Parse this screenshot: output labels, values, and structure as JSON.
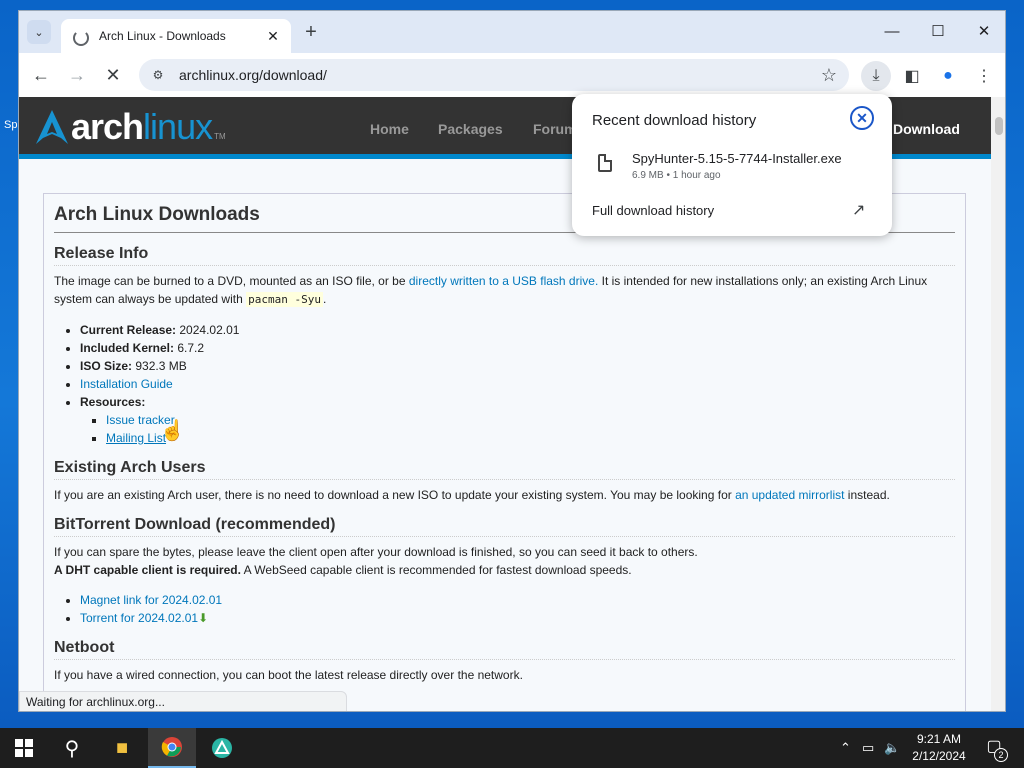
{
  "desktop": {
    "fragment_text": "Sp"
  },
  "browser": {
    "tab": {
      "title": "Arch Linux - Downloads",
      "close_glyph": "✕"
    },
    "new_tab_glyph": "+",
    "window_controls": {
      "minimize": "—",
      "maximize": "☐",
      "close": "✕"
    },
    "url": "archlinux.org/download/",
    "status_text": "Waiting for archlinux.org..."
  },
  "arch_header": {
    "logo_arch": "arch",
    "logo_linux": "linux",
    "logo_tm": "TM",
    "nav": [
      "Home",
      "Packages",
      "Forum",
      "Download"
    ]
  },
  "content": {
    "title": "Arch Linux Downloads",
    "release_info": {
      "heading": "Release Info",
      "intro_1": "The image can be burned to a DVD, mounted as an ISO file, or be ",
      "intro_link": "directly written to a USB flash drive.",
      "intro_2": " It is intended for new installations only; an existing Arch Linux system can always be updated with ",
      "intro_code": "pacman -Syu",
      "intro_3": ".",
      "current_release_label": "Current Release:",
      "current_release_value": " 2024.02.01",
      "kernel_label": "Included Kernel:",
      "kernel_value": " 6.7.2",
      "iso_label": "ISO Size:",
      "iso_value": " 932.3 MB",
      "install_guide": "Installation Guide",
      "resources_label": "Resources:",
      "resources": [
        "Issue tracker",
        "Mailing List"
      ]
    },
    "existing_users": {
      "heading": "Existing Arch Users",
      "text_1": "If you are an existing Arch user, there is no need to download a new ISO to update your existing system. You may be looking for ",
      "link": "an updated mirrorlist",
      "text_2": " instead."
    },
    "bittorrent": {
      "heading": "BitTorrent Download (recommended)",
      "text_1": "If you can spare the bytes, please leave the client open after your download is finished, so you can seed it back to others.",
      "bold": "A DHT capable client is required.",
      "text_2": " A WebSeed capable client is recommended for fastest download speeds.",
      "links": [
        "Magnet link for 2024.02.01",
        "Torrent for 2024.02.01"
      ]
    },
    "netboot": {
      "heading": "Netboot",
      "text": "If you have a wired connection, you can boot the latest release directly over the network."
    }
  },
  "download_popup": {
    "title": "Recent download history",
    "file_name": "SpyHunter-5.15-5-7744-Installer.exe",
    "file_meta": "6.9 MB • 1 hour ago",
    "full_history": "Full download history"
  },
  "taskbar": {
    "time": "9:21 AM",
    "date": "2/12/2024",
    "notification_count": "2"
  }
}
